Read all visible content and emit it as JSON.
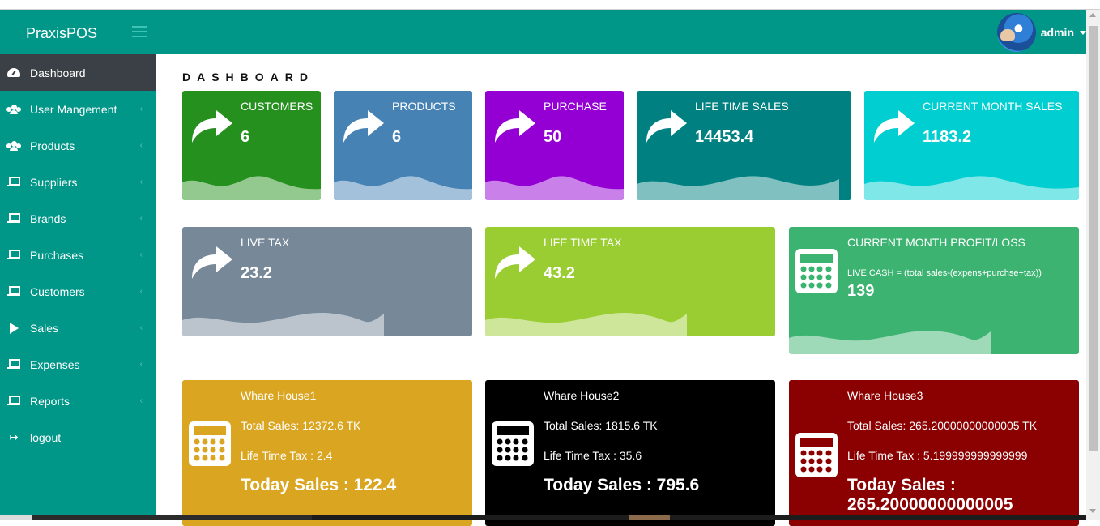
{
  "app": {
    "brand": "PraxisPOS",
    "user_name": "admin"
  },
  "sidebar": {
    "items": [
      {
        "label": "Dashboard",
        "icon": "dashboard-icon",
        "active": true
      },
      {
        "label": "User Mangement",
        "icon": "users-icon",
        "has_submenu": true
      },
      {
        "label": "Products",
        "icon": "users-icon",
        "has_submenu": true
      },
      {
        "label": "Suppliers",
        "icon": "laptop-icon",
        "has_submenu": true
      },
      {
        "label": "Brands",
        "icon": "laptop-icon",
        "has_submenu": true
      },
      {
        "label": "Purchases",
        "icon": "laptop-icon",
        "has_submenu": true
      },
      {
        "label": "Customers",
        "icon": "laptop-icon",
        "has_submenu": true
      },
      {
        "label": "Sales",
        "icon": "play-icon",
        "has_submenu": true
      },
      {
        "label": "Expenses",
        "icon": "laptop-icon",
        "has_submenu": true
      },
      {
        "label": "Reports",
        "icon": "laptop-icon",
        "has_submenu": true
      },
      {
        "label": "logout",
        "icon": "logout-icon",
        "has_submenu": false
      }
    ],
    "chevron": "‹"
  },
  "main": {
    "title": "DASHBOARD",
    "stats_row1": [
      {
        "label": "CUSTOMERS",
        "value": "6",
        "color": "#26901f",
        "icon": "share-icon"
      },
      {
        "label": "PRODUCTS",
        "value": "6",
        "color": "#4682b4",
        "icon": "share-icon"
      },
      {
        "label": "PURCHASE",
        "value": "50",
        "color": "#9400d3",
        "icon": "share-icon"
      },
      {
        "label": "LIFE TIME SALES",
        "value": "14453.4",
        "color": "#008080",
        "icon": "share-icon"
      },
      {
        "label": "CURRENT MONTH SALES",
        "value": "1183.2",
        "color": "#00ced1",
        "icon": "share-icon"
      }
    ],
    "stats_row2": [
      {
        "label": "LIVE TAX",
        "value": "23.2",
        "color": "#778899",
        "icon": "share-icon"
      },
      {
        "label": "LIFE TIME TAX",
        "value": "43.2",
        "color": "#9acd32",
        "icon": "share-icon"
      }
    ],
    "profit": {
      "label": "CURRENT MONTH PROFIT/LOSS",
      "formula": "LIVE CASH = (total sales-(expens+purchse+tax))",
      "value": "139",
      "color": "#3cb371",
      "icon": "calculator-icon"
    },
    "warehouses": [
      {
        "name": "Whare House1",
        "total_sales": "Total Sales: 12372.6 TK",
        "tax": "Life Time Tax : 2.4",
        "today": "Today Sales : 122.4",
        "color": "#daa520"
      },
      {
        "name": "Whare House2",
        "total_sales": "Total Sales: 1815.6 TK",
        "tax": "Life Time Tax : 35.6",
        "today": "Today Sales : 795.6",
        "color": "#000000"
      },
      {
        "name": "Whare House3",
        "total_sales": "Total Sales: 265.20000000000005 TK",
        "tax": "Life Time Tax : 5.199999999999999",
        "today": "Today Sales : 265.20000000000005",
        "color": "#8b0000"
      }
    ]
  }
}
